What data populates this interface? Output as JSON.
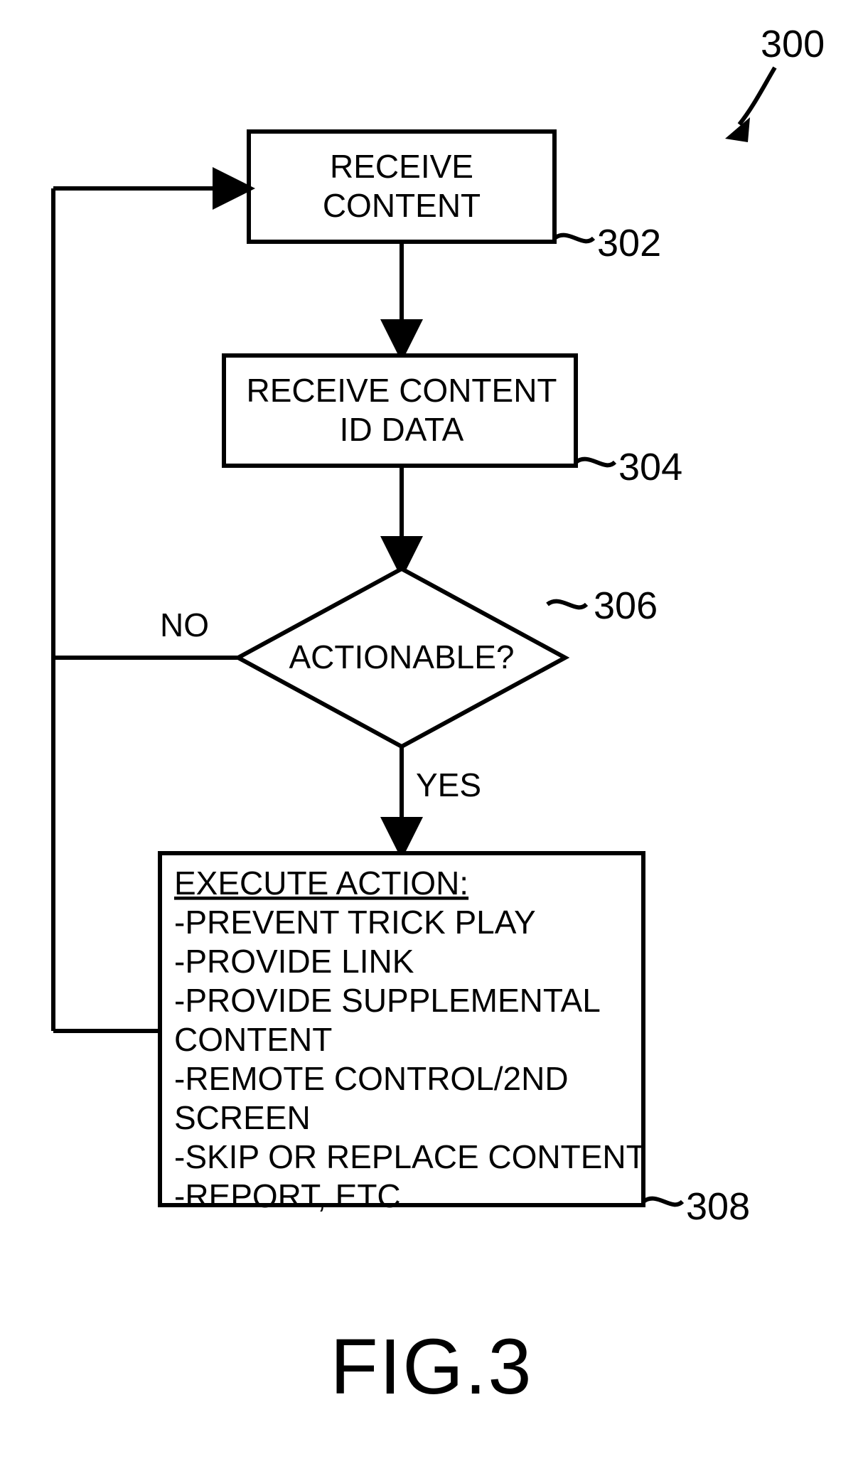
{
  "figureRef": "300",
  "figureCaption": "FIG.3",
  "nodes": {
    "receiveContent": {
      "line1": "RECEIVE",
      "line2": "CONTENT",
      "ref": "302"
    },
    "receiveIdData": {
      "line1": "RECEIVE CONTENT",
      "line2": "ID DATA",
      "ref": "304"
    },
    "actionable": {
      "text": "ACTIONABLE?",
      "ref": "306"
    },
    "executeAction": {
      "title": "EXECUTE ACTION:",
      "items": [
        "-PREVENT TRICK PLAY",
        "-PROVIDE LINK",
        "-PROVIDE SUPPLEMENTAL",
        "CONTENT",
        "-REMOTE CONTROL/2ND",
        "SCREEN",
        "-SKIP OR REPLACE CONTENT",
        "-REPORT, ETC."
      ],
      "ref": "308"
    }
  },
  "edges": {
    "no": "NO",
    "yes": "YES"
  }
}
